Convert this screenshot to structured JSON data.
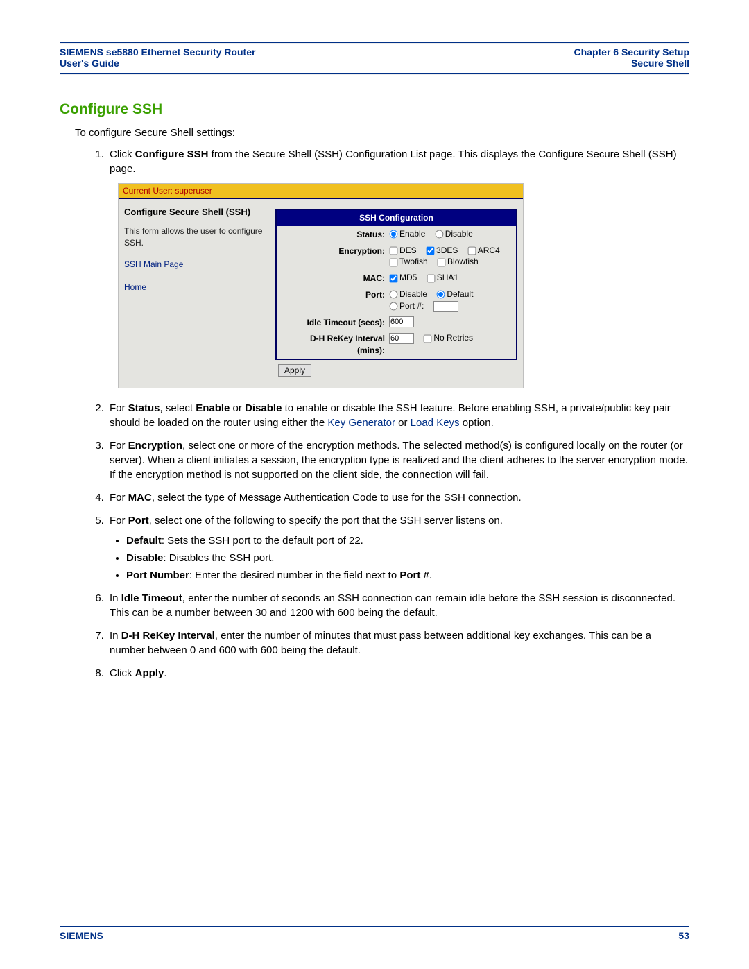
{
  "header": {
    "left_line1": "SIEMENS se5880 Ethernet Security Router",
    "left_line2": "User's Guide",
    "right_line1": "Chapter 6  Security Setup",
    "right_line2": "Secure Shell"
  },
  "section_title": "Configure SSH",
  "intro_text": "To configure Secure Shell settings:",
  "screenshot": {
    "current_user_label": "Current User: superuser",
    "left": {
      "title": "Configure Secure Shell (SSH)",
      "desc": "This form allows the user to configure SSH.",
      "link1": "SSH Main Page",
      "link2": "Home"
    },
    "panel_title": "SSH Configuration",
    "rows": {
      "status": {
        "label": "Status:",
        "enable": "Enable",
        "disable": "Disable",
        "selected": "enable"
      },
      "encryption": {
        "label": "Encryption:",
        "des": "DES",
        "tdes": "3DES",
        "arc4": "ARC4",
        "twofish": "Twofish",
        "blowfish": "Blowfish",
        "checked": [
          "3DES"
        ]
      },
      "mac": {
        "label": "MAC:",
        "md5": "MD5",
        "sha1": "SHA1",
        "checked": [
          "MD5"
        ]
      },
      "port": {
        "label": "Port:",
        "disable": "Disable",
        "default": "Default",
        "portnum": "Port #:",
        "selected": "default",
        "value": ""
      },
      "idle": {
        "label": "Idle Timeout (secs):",
        "value": "600"
      },
      "rekey": {
        "label": "D-H ReKey Interval (mins):",
        "value": "60",
        "noretries": "No Retries"
      }
    },
    "apply_label": "Apply"
  },
  "steps": {
    "s1_a": "Click ",
    "s1_b": "Configure SSH",
    "s1_c": " from the Secure Shell (SSH) Configuration List page. This displays the Configure Secure Shell (SSH) page.",
    "s2_a": "For ",
    "s2_b": "Status",
    "s2_c": ", select ",
    "s2_d": "Enable",
    "s2_e": " or ",
    "s2_f": "Disable",
    "s2_g": " to enable or disable the SSH feature. Before enabling SSH, a private/public key pair should be loaded on the router using either the ",
    "s2_link1": "Key Generator",
    "s2_h": " or ",
    "s2_link2": "Load Keys",
    "s2_i": " option.",
    "s3_a": "For ",
    "s3_b": "Encryption",
    "s3_c": ", select one or more of the encryption methods. The selected method(s) is configured locally on the router (or server). When a client initiates a session, the encryption type is realized and the client adheres to the server encryption mode. If the encryption method is not supported on the client side, the connection will fail.",
    "s4_a": "For ",
    "s4_b": "MAC",
    "s4_c": ", select the type of Message Authentication Code to use for the SSH connection.",
    "s5_a": "For ",
    "s5_b": "Port",
    "s5_c": ", select one of the following to specify the port that the SSH server listens on.",
    "s5_bul1_b": "Default",
    "s5_bul1_t": ": Sets the SSH port to the default port of 22.",
    "s5_bul2_b": "Disable",
    "s5_bul2_t": ": Disables the SSH port.",
    "s5_bul3_b": "Port Number",
    "s5_bul3_t": ": Enter the desired number in the field next to ",
    "s5_bul3_b2": "Port #",
    "s5_bul3_t2": ".",
    "s6_a": "In ",
    "s6_b": "Idle Timeout",
    "s6_c": ", enter the number of seconds an SSH connection can remain idle before the SSH session is disconnected. This can be a number between 30 and 1200 with 600 being the default.",
    "s7_a": "In ",
    "s7_b": "D-H ReKey Interval",
    "s7_c": ", enter the number of minutes that must pass between additional key exchanges. This can be a number between 0 and 600 with 600 being the default.",
    "s8_a": "Click ",
    "s8_b": "Apply",
    "s8_c": "."
  },
  "footer": {
    "brand": "SIEMENS",
    "page": "53"
  }
}
